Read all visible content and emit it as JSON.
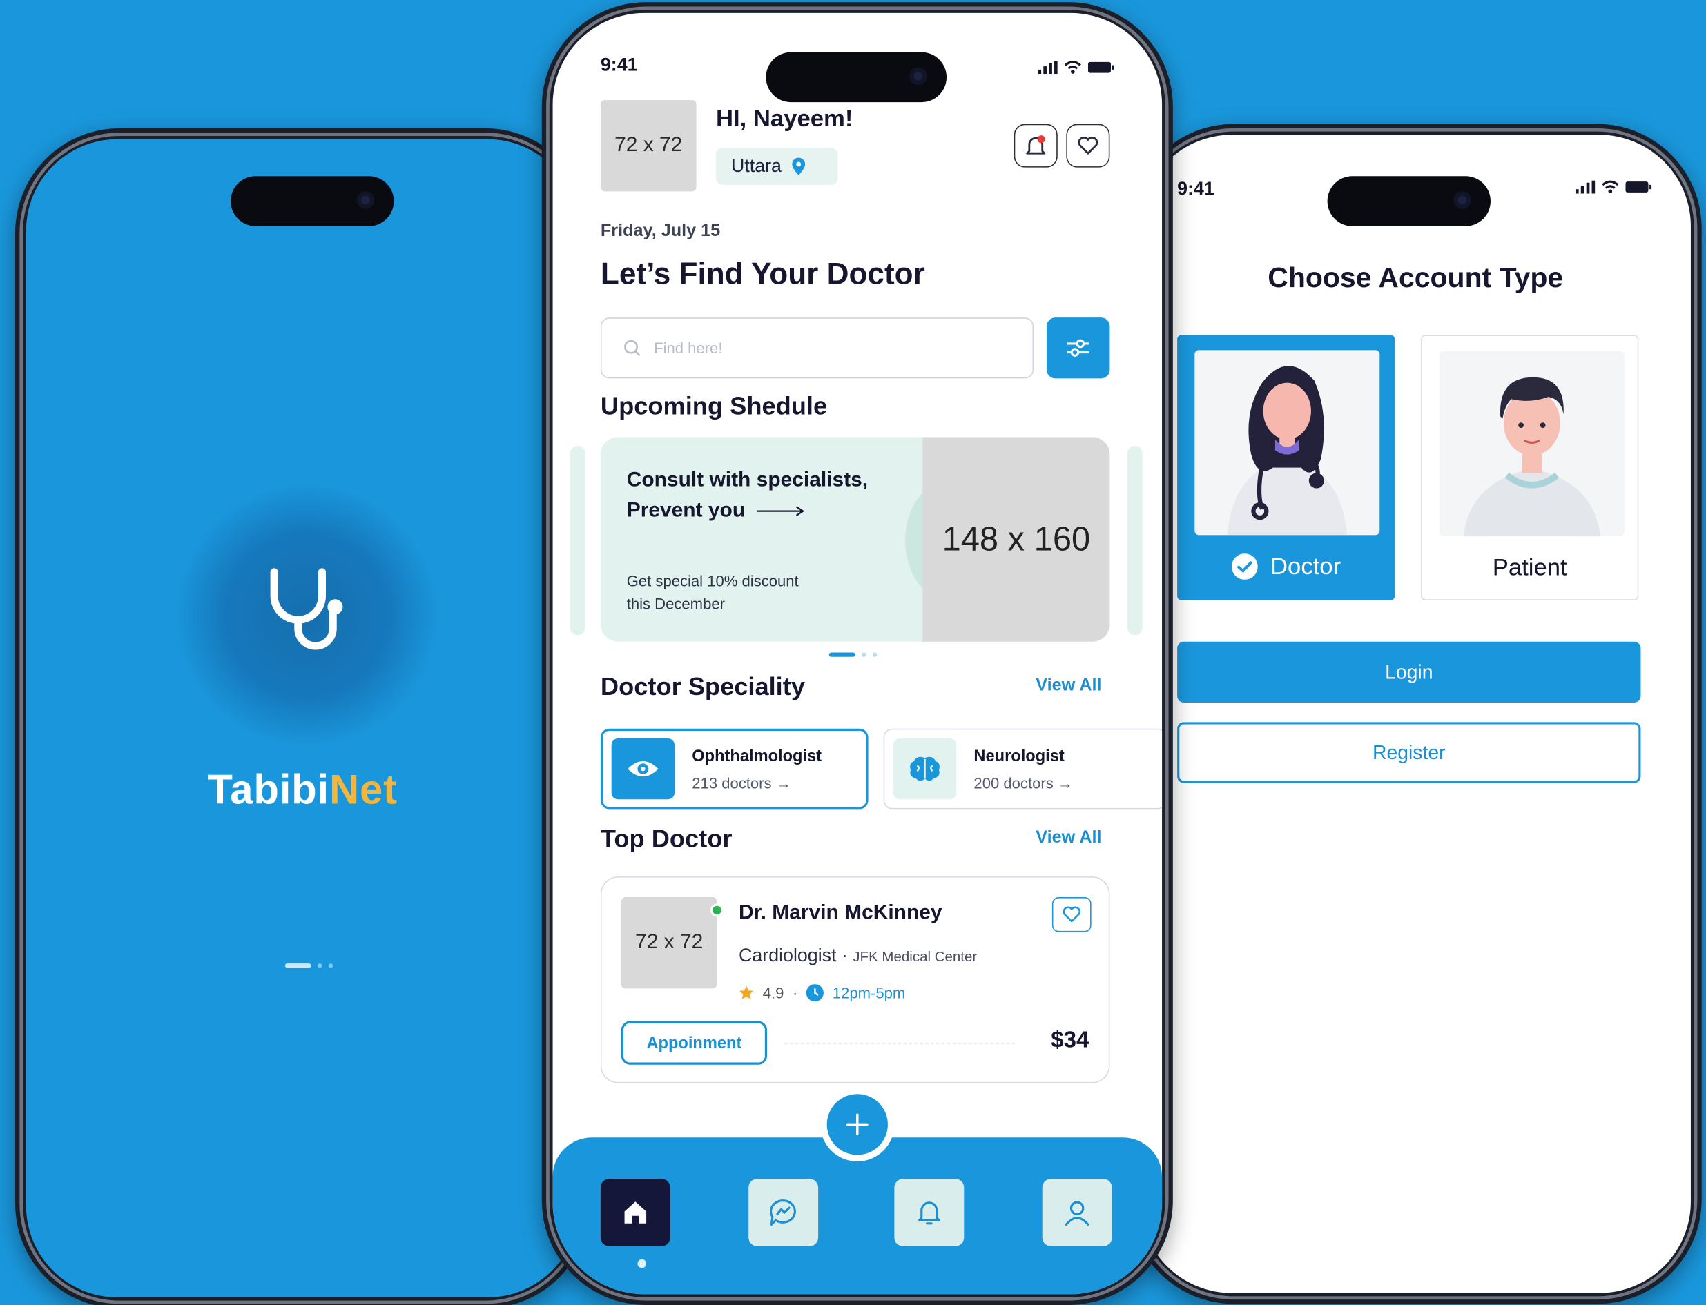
{
  "splash": {
    "brand_main": "Tabibi",
    "brand_accent": "Net",
    "colors": {
      "background": "#1a97dc",
      "accent": "#f5b43a"
    }
  },
  "home": {
    "status_time": "9:41",
    "avatar_placeholder": "72 x 72",
    "greeting": "HI, Nayeem!",
    "location": "Uttara",
    "date": "Friday, July 15",
    "headline": "Let’s Find Your Doctor",
    "search_placeholder": "Find here!",
    "upcoming_title": "Upcoming Shedule",
    "promo": {
      "title_line1": "Consult with specialists,",
      "title_line2": "Prevent you",
      "subtitle_line1": "Get special 10% discount",
      "subtitle_line2": "this December",
      "image_placeholder": "148 x 160"
    },
    "speciality_title": "Doctor Speciality",
    "speciality_view_all": "View All",
    "specialities": [
      {
        "name": "Ophthalmologist",
        "count": "213 doctors",
        "icon": "eye-icon"
      },
      {
        "name": "Neurologist",
        "count": "200 doctors",
        "icon": "brain-icon"
      }
    ],
    "top_doctor_title": "Top Doctor",
    "top_doctor_view_all": "View All",
    "doctor": {
      "photo_placeholder": "72 x 72",
      "name": "Dr. Marvin McKinney",
      "specialty": "Cardiologist",
      "hospital": "JFK Medical Center",
      "rating": "4.9",
      "hours": "12pm-5pm",
      "button": "Appoinment",
      "price": "$34"
    },
    "nav": [
      "home-icon",
      "chat-icon",
      "bell-icon",
      "user-icon"
    ],
    "arrow": "→"
  },
  "account": {
    "status_time": "9:41",
    "title": "Choose Account Type",
    "doctor_label": "Doctor",
    "patient_label": "Patient",
    "login": "Login",
    "register": "Register"
  }
}
